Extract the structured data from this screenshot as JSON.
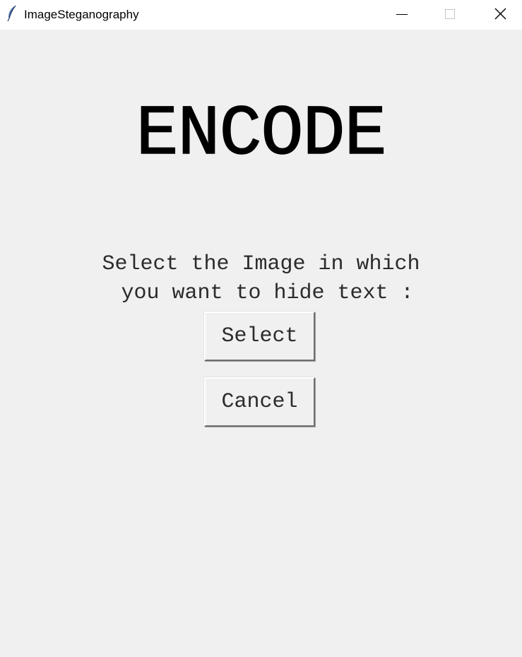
{
  "window": {
    "title": "ImageSteganography",
    "controls": {
      "minimize": "minimize-icon",
      "maximize": "maximize-icon",
      "close": "close-icon"
    },
    "app_icon": "feather-icon"
  },
  "main": {
    "heading": "ENCODE",
    "prompt_line1": "Select the Image in which",
    "prompt_line2": " you want to hide text :",
    "select_label": "Select",
    "cancel_label": "Cancel"
  },
  "colors": {
    "background": "#f0f0f0",
    "titlebar": "#ffffff",
    "text": "#000000"
  }
}
